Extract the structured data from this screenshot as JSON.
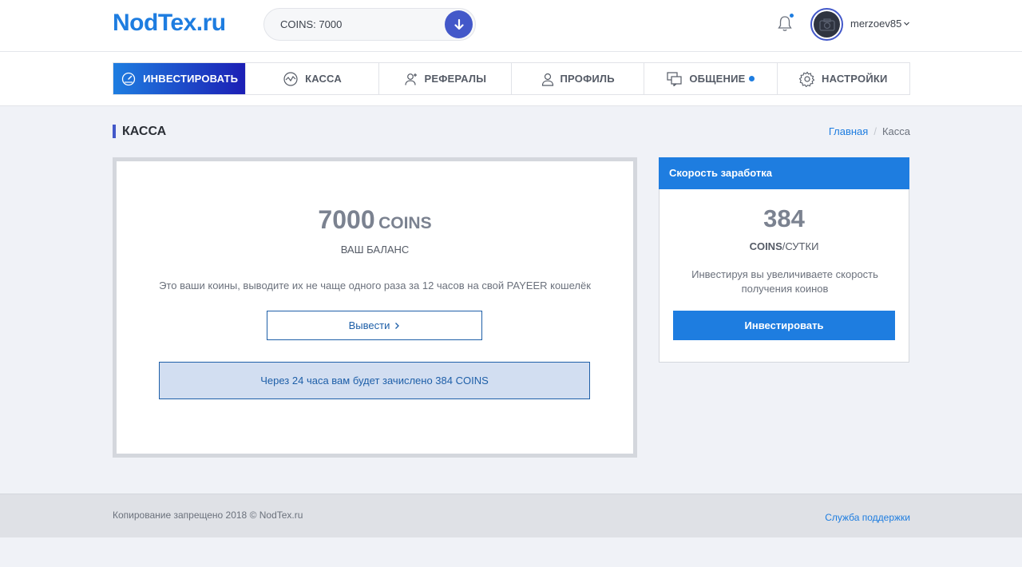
{
  "header": {
    "logo": "NodTex.ru",
    "search_value": "COINS: 7000",
    "username": "merzoev85"
  },
  "nav": {
    "items": [
      {
        "label": "ИНВЕСТИРОВАТЬ",
        "icon": "speedometer-icon",
        "active": true
      },
      {
        "label": "КАССА",
        "icon": "wave-icon"
      },
      {
        "label": "РЕФЕРАЛЫ",
        "icon": "user-plus-icon"
      },
      {
        "label": "ПРОФИЛЬ",
        "icon": "user-icon"
      },
      {
        "label": "ОБЩЕНИЕ",
        "icon": "chat-icon",
        "has_dot": true
      },
      {
        "label": "НАСТРОЙКИ",
        "icon": "gear-icon"
      }
    ]
  },
  "page": {
    "title": "КАССА",
    "breadcrumb": {
      "home": "Главная",
      "current": "Касса"
    }
  },
  "balance_card": {
    "amount": "7000",
    "unit": "COINS",
    "label": "ВАШ БАЛАНС",
    "note": "Это ваши коины, выводите их не чаще одного раза за 12 часов на свой PAYEER кошелёк",
    "withdraw_label": "Вывести",
    "alert": "Через 24 часа вам будет зачислено 384 COINS"
  },
  "speed_card": {
    "header": "Скорость заработка",
    "amount": "384",
    "unit_coins": "COINS",
    "unit_rest": "/СУТКИ",
    "text": "Инвестируя вы увеличиваете скорость получения коинов",
    "button": "Инвестировать"
  },
  "footer": {
    "copyright": "Копирование запрещено 2018 © NodTex.ru",
    "support": "Служба поддержки"
  },
  "colors": {
    "accent": "#1e7de0",
    "accent_dark": "#1c1fb5",
    "indigo": "#4358c9"
  }
}
